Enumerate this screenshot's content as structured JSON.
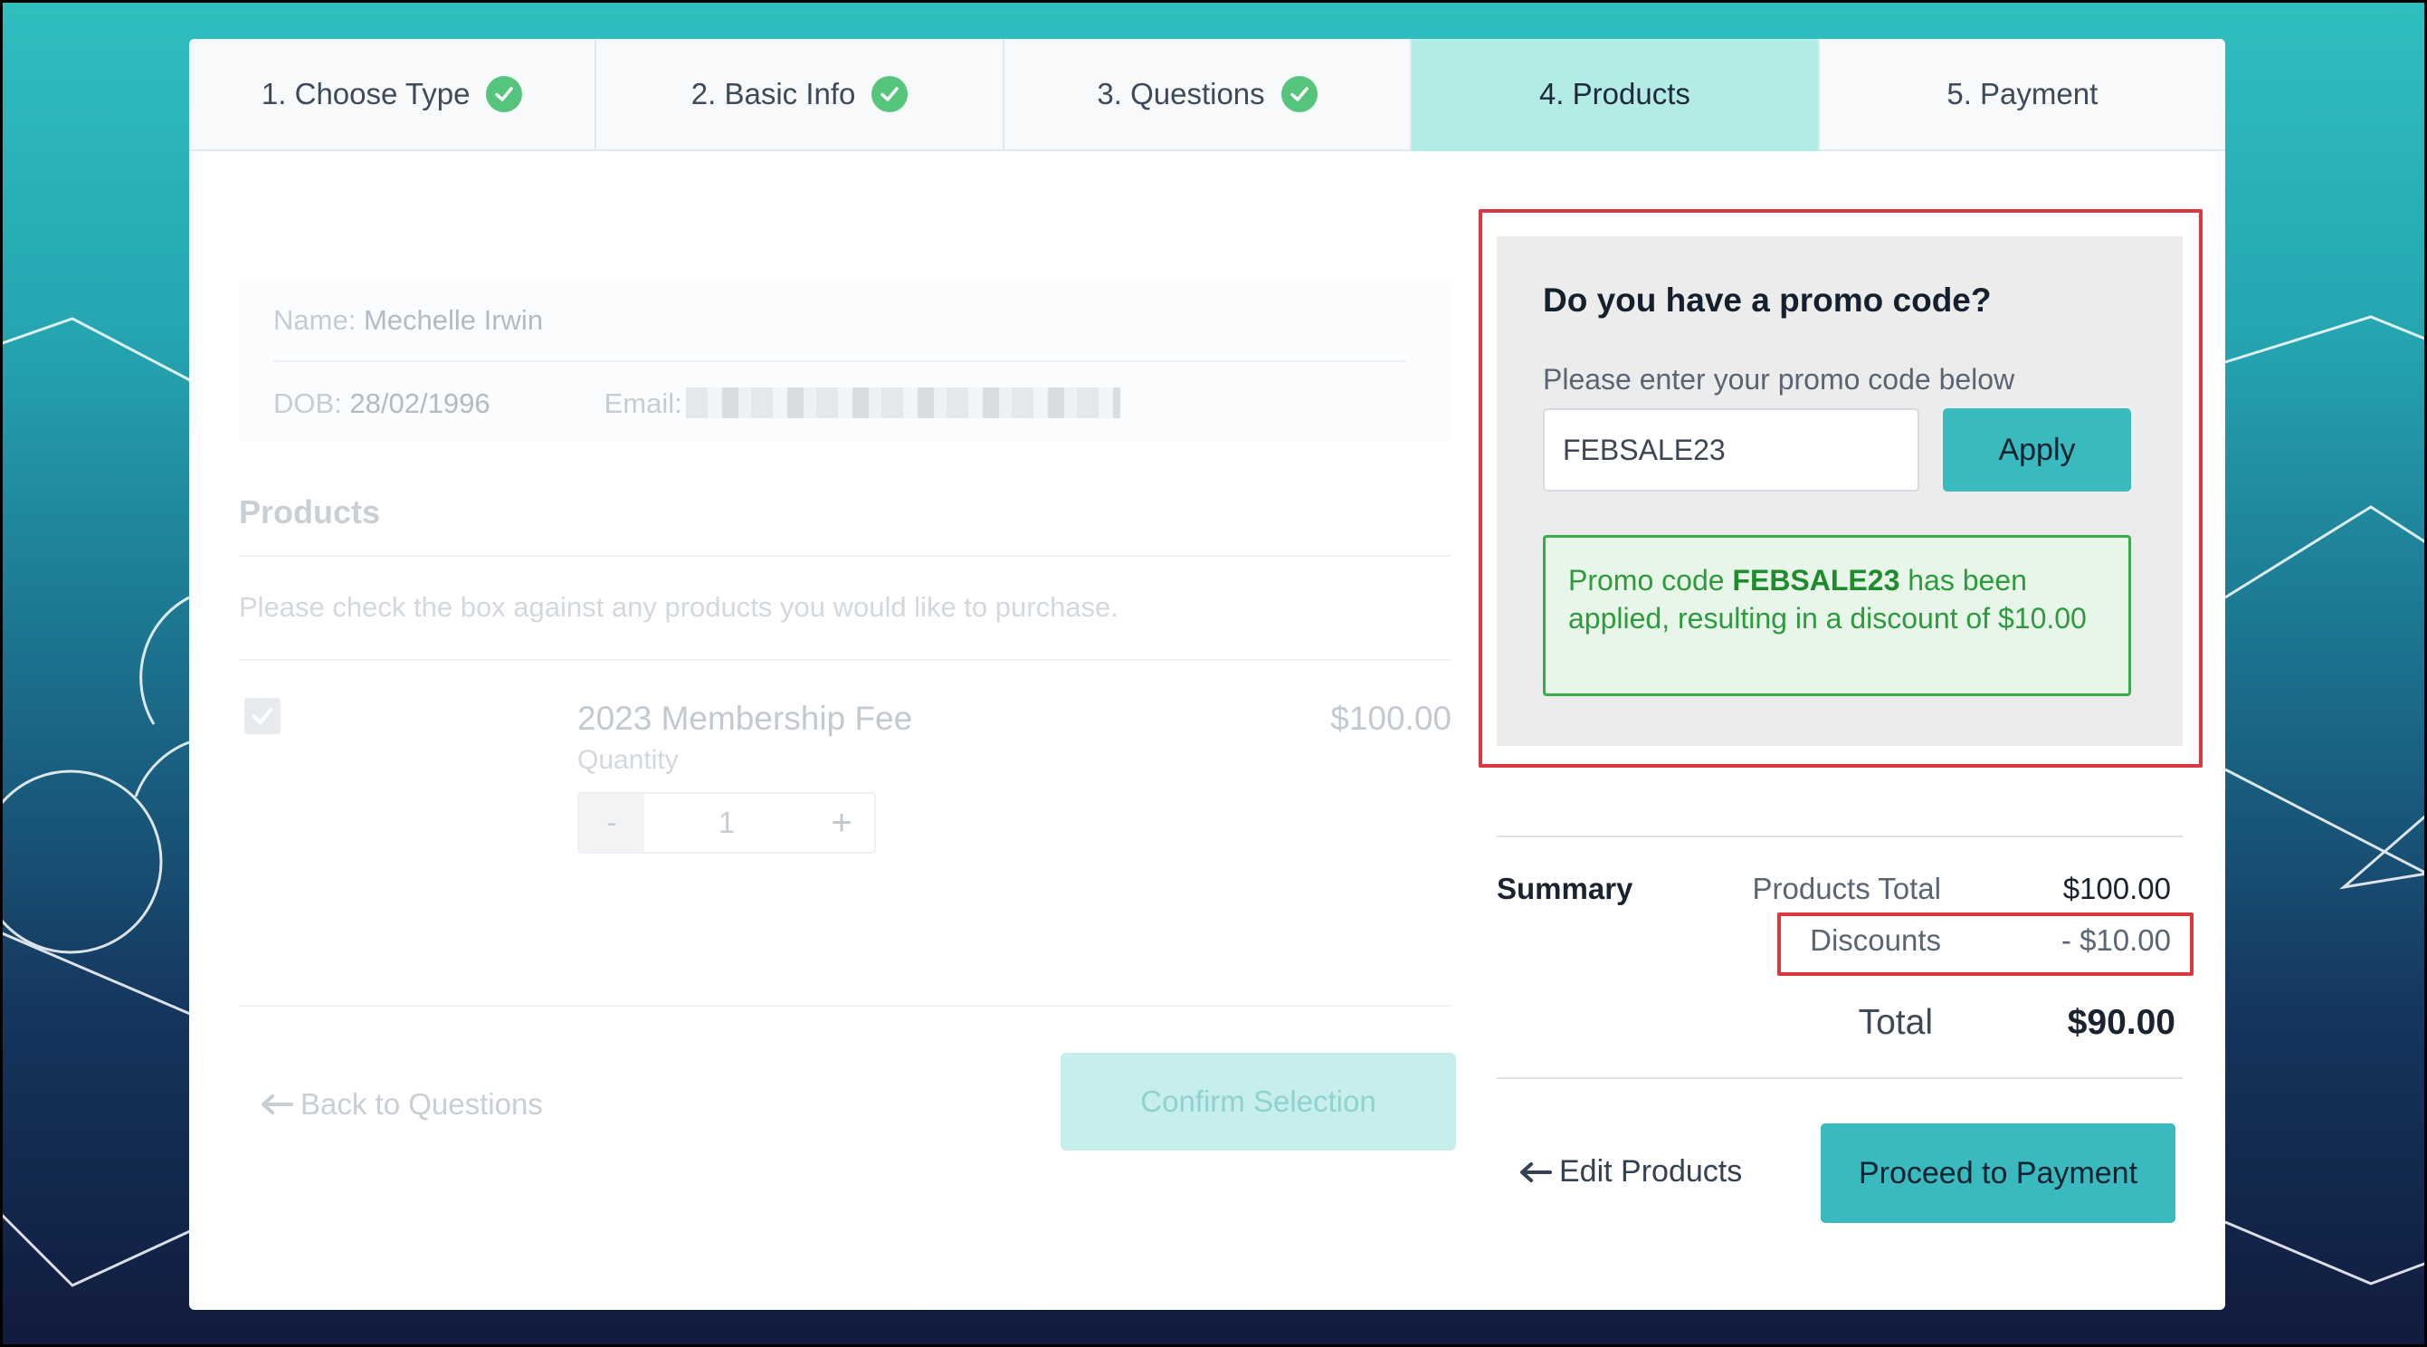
{
  "tabs": [
    {
      "label": "1. Choose Type",
      "completed": true
    },
    {
      "label": "2. Basic Info",
      "completed": true
    },
    {
      "label": "3. Questions",
      "completed": true
    },
    {
      "label": "4. Products",
      "active": true
    },
    {
      "label": "5. Payment"
    }
  ],
  "member": {
    "name_label": "Name:",
    "name": "Mechelle Irwin",
    "dob_label": "DOB:",
    "dob": "28/02/1996",
    "email_label": "Email:"
  },
  "products": {
    "heading": "Products",
    "description": "Please check the box against any products you would like to purchase.",
    "item": {
      "name": "2023 Membership Fee",
      "quantity_label": "Quantity",
      "quantity": "1",
      "price": "$100.00",
      "checked": true
    },
    "minus_label": "-",
    "plus_label": "+",
    "back_label": "Back to Questions",
    "confirm_label": "Confirm Selection"
  },
  "promo": {
    "title": "Do you have a promo code?",
    "subtitle": "Please enter your promo code below",
    "input_value": "FEBSALE23",
    "apply_label": "Apply",
    "message_prefix": "Promo code ",
    "message_code": "FEBSALE23",
    "message_suffix": " has been applied, resulting in a discount of $10.00"
  },
  "summary": {
    "label": "Summary",
    "products_total_label": "Products Total",
    "products_total": "$100.00",
    "discounts_label": "Discounts",
    "discounts": "- $10.00",
    "total_label": "Total",
    "total": "$90.00"
  },
  "actions": {
    "edit_label": "Edit Products",
    "proceed_label": "Proceed to Payment"
  },
  "colors": {
    "accent": "#3ab9be",
    "active_tab": "#b3ece6",
    "success": "#2f9a3d",
    "highlight": "#d9393e"
  }
}
